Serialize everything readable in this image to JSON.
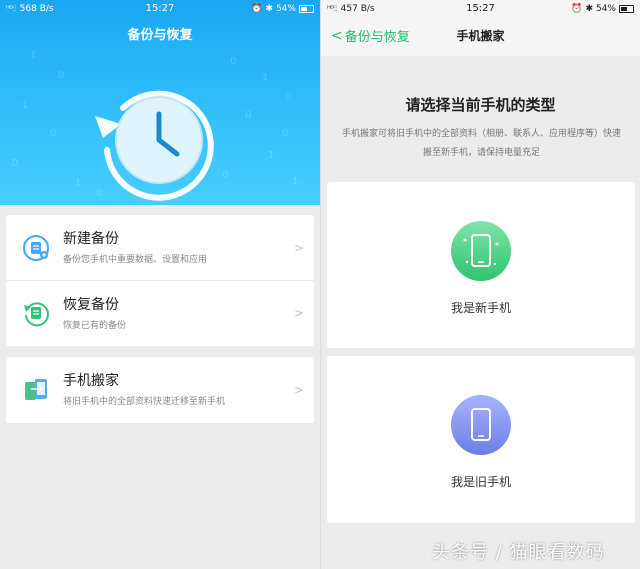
{
  "left": {
    "status": {
      "signal": "ᴴᴰ⫶⫶",
      "speed": "568 B/s",
      "time": "15:27",
      "battery": "54%"
    },
    "title": "备份与恢复",
    "binary_digits": [
      "1",
      "0",
      "1",
      "0",
      "0",
      "1",
      "0",
      "1",
      "0",
      "0",
      "1",
      "0",
      "1",
      "0",
      "0"
    ],
    "items": [
      {
        "title": "新建备份",
        "subtitle": "备份您手机中重要数据、设置和应用",
        "icon": "new-backup-icon"
      },
      {
        "title": "恢复备份",
        "subtitle": "恢复已有的备份",
        "icon": "restore-backup-icon"
      },
      {
        "title": "手机搬家",
        "subtitle": "将旧手机中的全部资料快速迁移至新手机",
        "icon": "phone-move-icon"
      }
    ]
  },
  "right": {
    "status": {
      "signal": "ᴴᴰ⫶⫶",
      "speed": "457 B/s",
      "time": "15:27",
      "battery": "54%"
    },
    "back_label": "备份与恢复",
    "title": "手机搬家",
    "question": "请选择当前手机的类型",
    "description": "手机搬家可将旧手机中的全部资料（相册、联系人、应用程序等）快速搬至新手机，请保持电量充足",
    "options": [
      {
        "label": "我是新手机",
        "color": "#3fd27f"
      },
      {
        "label": "我是旧手机",
        "color": "#7f8ff0"
      }
    ]
  },
  "watermark": "头条号 / 猫眼看数码",
  "colors": {
    "accent_green": "#1cbe6c",
    "hero_blue": "#1aa7f2"
  }
}
